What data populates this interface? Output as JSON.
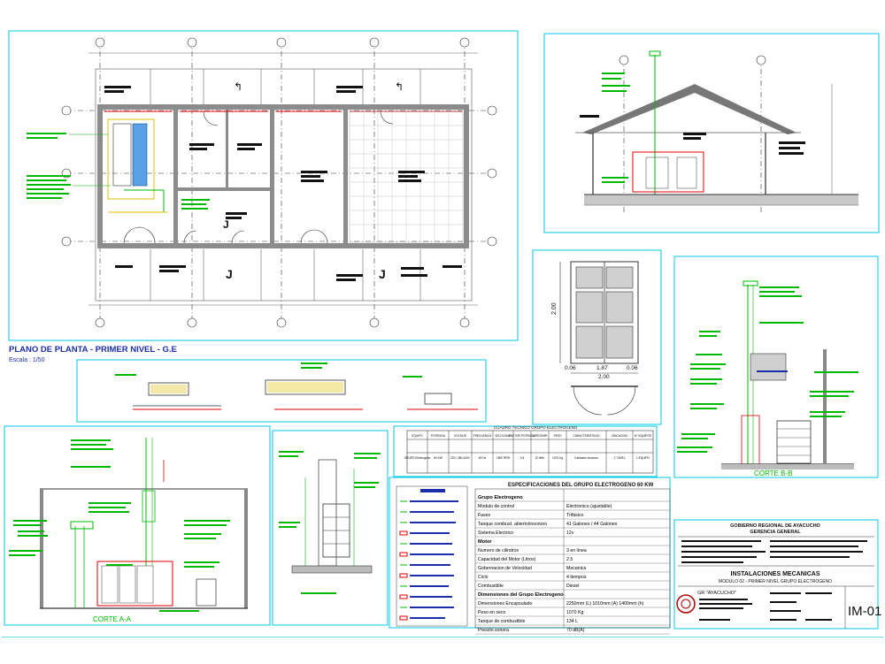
{
  "plan": {
    "title": "PLANO DE PLANTA - PRIMER NIVEL - G.E",
    "scale": "Escala : 1/50"
  },
  "cuts": {
    "aa_title": "CORTE A-A",
    "bb_title": "CORTE B-B",
    "bb_labels": {
      "sombrero": "SOMBRERO TIPO CHINO PAR DESCARGA DE GASES DE LA COMBUSTION",
      "tuberia_escape": "TUBERIA DE ESCAPE DE 4\"Ø",
      "silenciador": "SILENCIADOR",
      "compensador": "COMPENSADOR DE DILATACION",
      "codo": "CODO LARGO DE 90° DE 4\"Ø",
      "canaleta": "CANALETA DE METAL",
      "tuberia_retorno": "TUBERIA DE RETORNO"
    },
    "aa_labels": {
      "sombrero": "SOMBRERO TIPO CHINO PAR DESCARGA DE GASES DE LA COMBUSTION",
      "tuberia_escape": "TUBERIA DE ESCAPE DE 4\"Ø",
      "tanque": "TANQUE DIARIO DE 50 GLNS",
      "retorno": "TUBERIA DE RETORNO DE 3/4\"Ø",
      "cuadro": "CUADRO DE GRUPO",
      "escape": "CANALETA DE METAL"
    }
  },
  "door": {
    "dim_width": "2.00",
    "dim_height": "2.00",
    "dim_left": "0.06",
    "dim_mid": "1.87",
    "dim_right": "0.06"
  },
  "equipment_table": {
    "title": "CUADRO TECNICO GRUPO ELECTROGENO",
    "headers": [
      "EQUIPO",
      "POTENCIA",
      "VOLTAJE",
      "FRECUENCIA",
      "VELOCIDAD",
      "FACTOR POTENCIA",
      "LITROS/HR",
      "PESO",
      "CARACTERISTICAS",
      "UBICACION",
      "N° EQUIPOS"
    ],
    "row": [
      "GRUPO Electrogeno",
      "60 KW",
      "220 / 380-440V",
      "60 Hz",
      "1800 RPM",
      "0.8",
      "10 lit/hr",
      "1070 Kg",
      "Cabinado Insonoro",
      "1° NIVEL",
      "1 EQUIPO"
    ]
  },
  "specs": {
    "title": "ESPECIFICACIONES DEL GRUPO ELECTROGENO 60 KW",
    "sections": [
      {
        "heading": "Grupo Electrogeno",
        "rows": [
          [
            "Modulo de control",
            "Electronico (ajustable)"
          ],
          [
            "Fases",
            "Trifásico"
          ],
          [
            "Tanque combust. abierto/insonoro",
            "41 Galones / 44 Galones"
          ],
          [
            "Sistema Electrico",
            "12v"
          ]
        ]
      },
      {
        "heading": "Motor",
        "rows": [
          [
            "Numero de cilindros",
            "3 en línea"
          ],
          [
            "Capacidad del Motor (Litros)",
            "2.5"
          ],
          [
            "Gobernacion de Velocidad",
            "Mecanica"
          ],
          [
            "Ciclo",
            "4 tiempos"
          ],
          [
            "Combustible",
            "Diesel"
          ]
        ]
      },
      {
        "heading": "Dimensiones del Grupo Electrogeno",
        "rows": [
          [
            "Dimensiones Encapsulado",
            "2250mm (L) 1010mm (A) 1400mm (h)"
          ],
          [
            "Peso en seco",
            "1070 Kg"
          ],
          [
            "Tanque de combustible",
            "134 L"
          ],
          [
            "Presión sonora",
            "70 dB(A)"
          ]
        ]
      }
    ]
  },
  "title_block": {
    "government": "GOBIERNO REGIONAL DE AYACUCHO",
    "management": "GERENCIA GENERAL",
    "discipline": "INSTALACIONES MECANICAS",
    "module": "MODULO 02 - PRIMER NIVEL GRUPO ELECTROGENO",
    "region": "GR \"AYACUCHO\"",
    "sheet_code": "IM-01"
  },
  "colors": {
    "panel_border": "#00c8e6",
    "wall": "#8c8c8c",
    "accent_red": "#e00000",
    "accent_green": "#00b800",
    "title_blue": "#1c2fa8"
  }
}
